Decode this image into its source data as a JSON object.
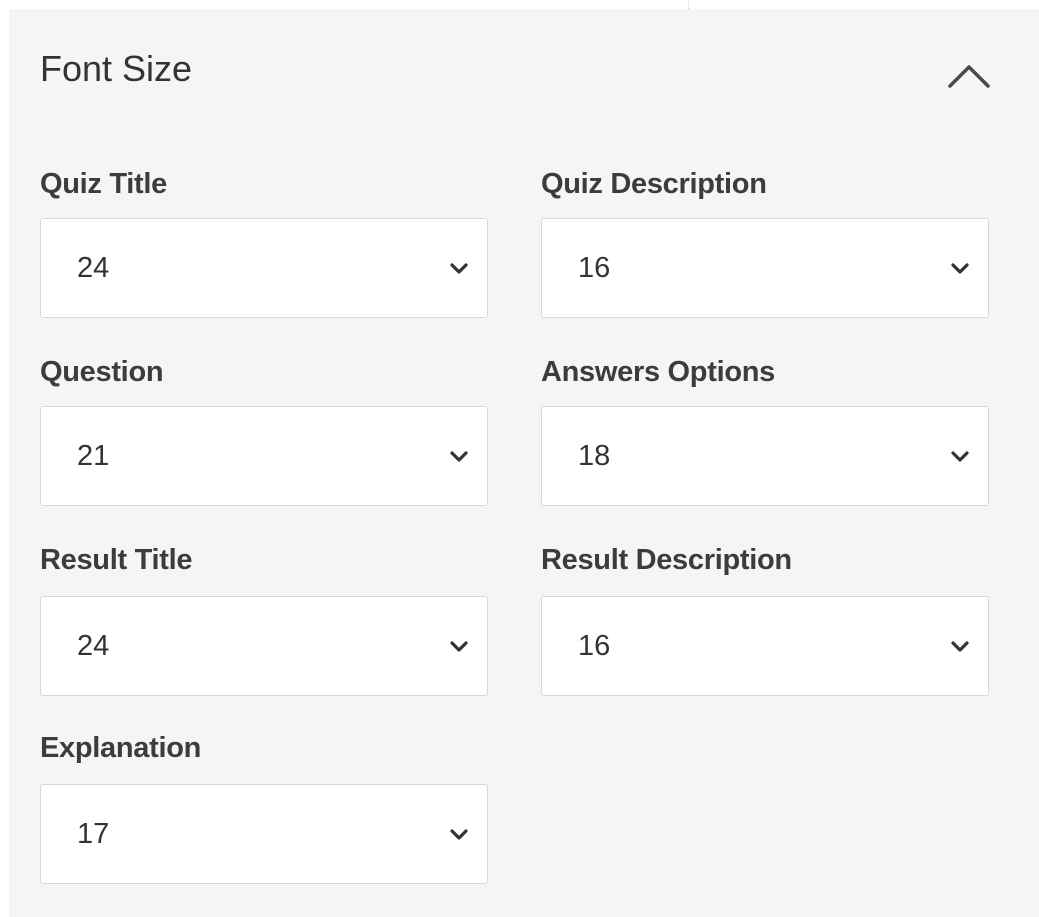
{
  "panel": {
    "title": "Font Size",
    "collapse_icon": "chevron-up-icon"
  },
  "fields": {
    "quiz_title": {
      "label": "Quiz Title",
      "value": "24"
    },
    "quiz_description": {
      "label": "Quiz Description",
      "value": "16"
    },
    "question": {
      "label": "Question",
      "value": "21"
    },
    "answers_options": {
      "label": "Answers Options",
      "value": "18"
    },
    "result_title": {
      "label": "Result Title",
      "value": "24"
    },
    "result_description": {
      "label": "Result Description",
      "value": "16"
    },
    "explanation": {
      "label": "Explanation",
      "value": "17"
    }
  },
  "select_icon": "chevron-down-icon",
  "colors": {
    "panel_bg": "#f5f5f5",
    "select_bg": "#ffffff",
    "select_border": "#d9d9d9",
    "text": "#333333"
  }
}
